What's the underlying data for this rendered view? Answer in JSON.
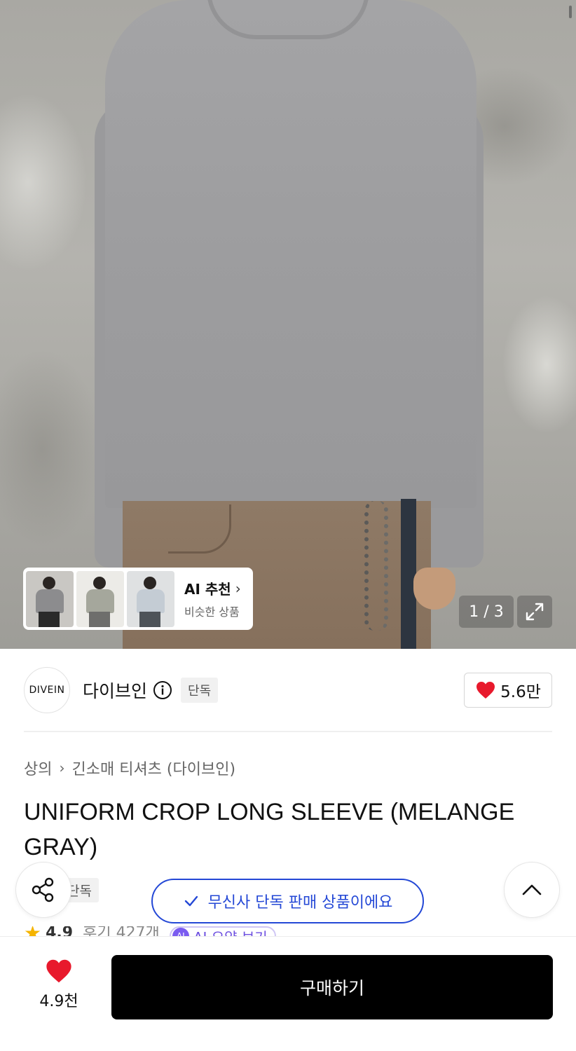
{
  "hero": {
    "image_counter": "1 / 3",
    "ai_recommend": {
      "title": "AI 추천",
      "subtitle": "비슷한 상품"
    }
  },
  "brand": {
    "logo_text": "DIVEIN",
    "name": "다이브인",
    "badge": "단독",
    "likes": "5.6만"
  },
  "breadcrumb": {
    "category": "상의",
    "subcategory": "긴소매 티셔츠 (다이브인)"
  },
  "product": {
    "title": "UNIFORM CROP LONG SLEEVE (MELANGE GRAY)",
    "badge": "단독",
    "rating": "4.9",
    "reviews": "후기 427개",
    "ai_summary": "AI 요약 보기",
    "ai_summary_icon_label": "AI"
  },
  "floating": {
    "exclusive_message": "무신사 단독 판매 상품이에요"
  },
  "bottom_bar": {
    "like_count": "4.9천",
    "buy_label": "구매하기"
  },
  "colors": {
    "accent_blue": "#2448d6",
    "heart_red": "#e8192c",
    "buy_button": "#000000"
  },
  "icons": [
    "info-icon",
    "heart-icon",
    "share-icon",
    "chevron-up-icon",
    "expand-icon",
    "check-icon",
    "chevron-right-icon",
    "star-icon"
  ]
}
